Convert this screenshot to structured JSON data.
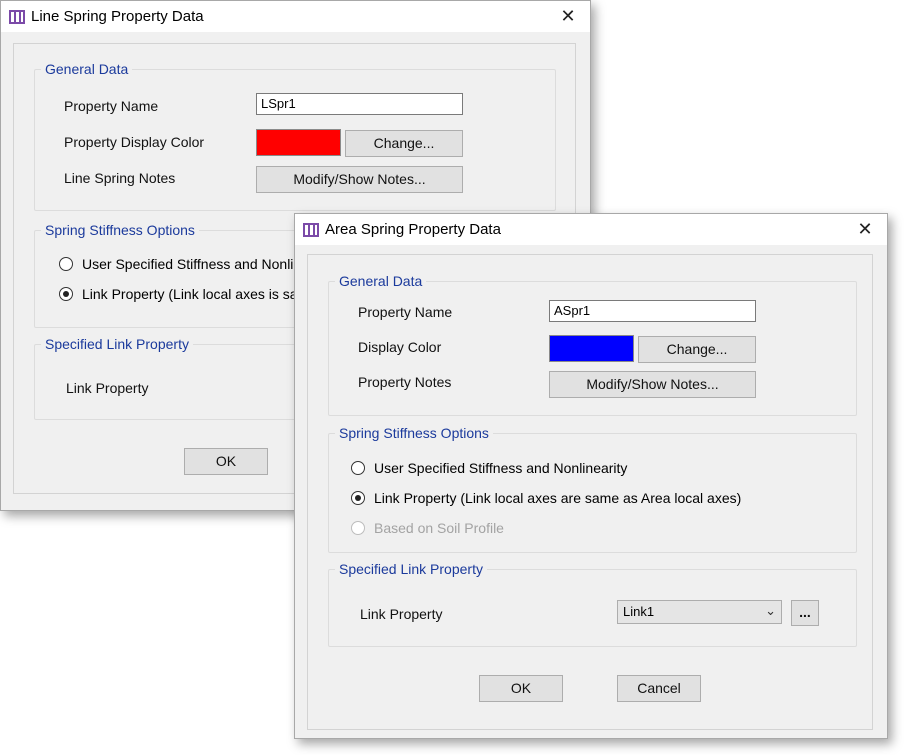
{
  "line_dialog": {
    "title": "Line Spring Property Data",
    "close": "✕",
    "general": {
      "title": "General Data",
      "name_label": "Property Name",
      "name_value": "LSpr1",
      "color_label": "Property Display Color",
      "color": "#ff0000",
      "change_label": "Change...",
      "notes_label": "Line Spring Notes",
      "notes_button": "Modify/Show Notes..."
    },
    "stiffness": {
      "title": "Spring Stiffness Options",
      "option1": "User Specified Stiffness and Nonline",
      "option2": "Link Property (Link local axes is same"
    },
    "link": {
      "title": "Specified Link Property",
      "label": "Link Property"
    },
    "ok_label": "OK"
  },
  "area_dialog": {
    "title": "Area Spring Property Data",
    "close": "✕",
    "general": {
      "title": "General Data",
      "name_label": "Property Name",
      "name_value": "ASpr1",
      "color_label": "Display Color",
      "color": "#0000ff",
      "change_label": "Change...",
      "notes_label": "Property Notes",
      "notes_button": "Modify/Show Notes..."
    },
    "stiffness": {
      "title": "Spring Stiffness Options",
      "option1": "User Specified Stiffness and Nonlinearity",
      "option2": "Link Property (Link local axes are same as Area local axes)",
      "option3": "Based on Soil Profile",
      "selected": "option2"
    },
    "link": {
      "title": "Specified Link Property",
      "label": "Link Property",
      "selected_value": "Link1",
      "more_label": "..."
    },
    "ok_label": "OK",
    "cancel_label": "Cancel"
  }
}
